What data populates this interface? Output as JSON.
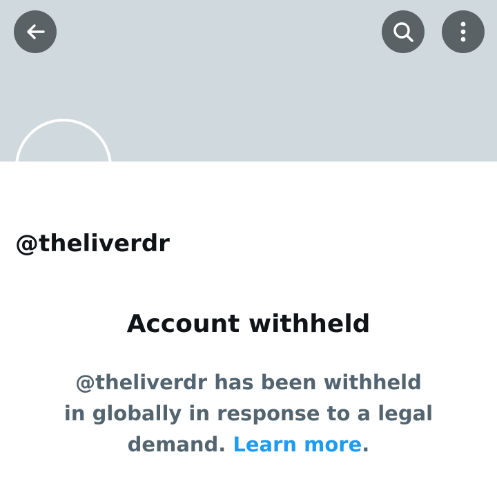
{
  "profile": {
    "handle": "@theliverdr"
  },
  "header": {
    "back_icon": "arrow-left-icon",
    "search_icon": "search-icon",
    "more_icon": "more-vertical-icon"
  },
  "notice": {
    "title": "Account withheld",
    "line1": "@theliverdr has been withheld",
    "line2": "in globally in response to a legal",
    "line3_prefix": "demand. ",
    "link": "Learn more",
    "line3_suffix": "."
  },
  "colors": {
    "banner": "#cfd9de",
    "icon_button_bg": "#5b6265",
    "primary_text": "#0f1419",
    "secondary_text": "#536471",
    "link": "#1d9bf0"
  }
}
